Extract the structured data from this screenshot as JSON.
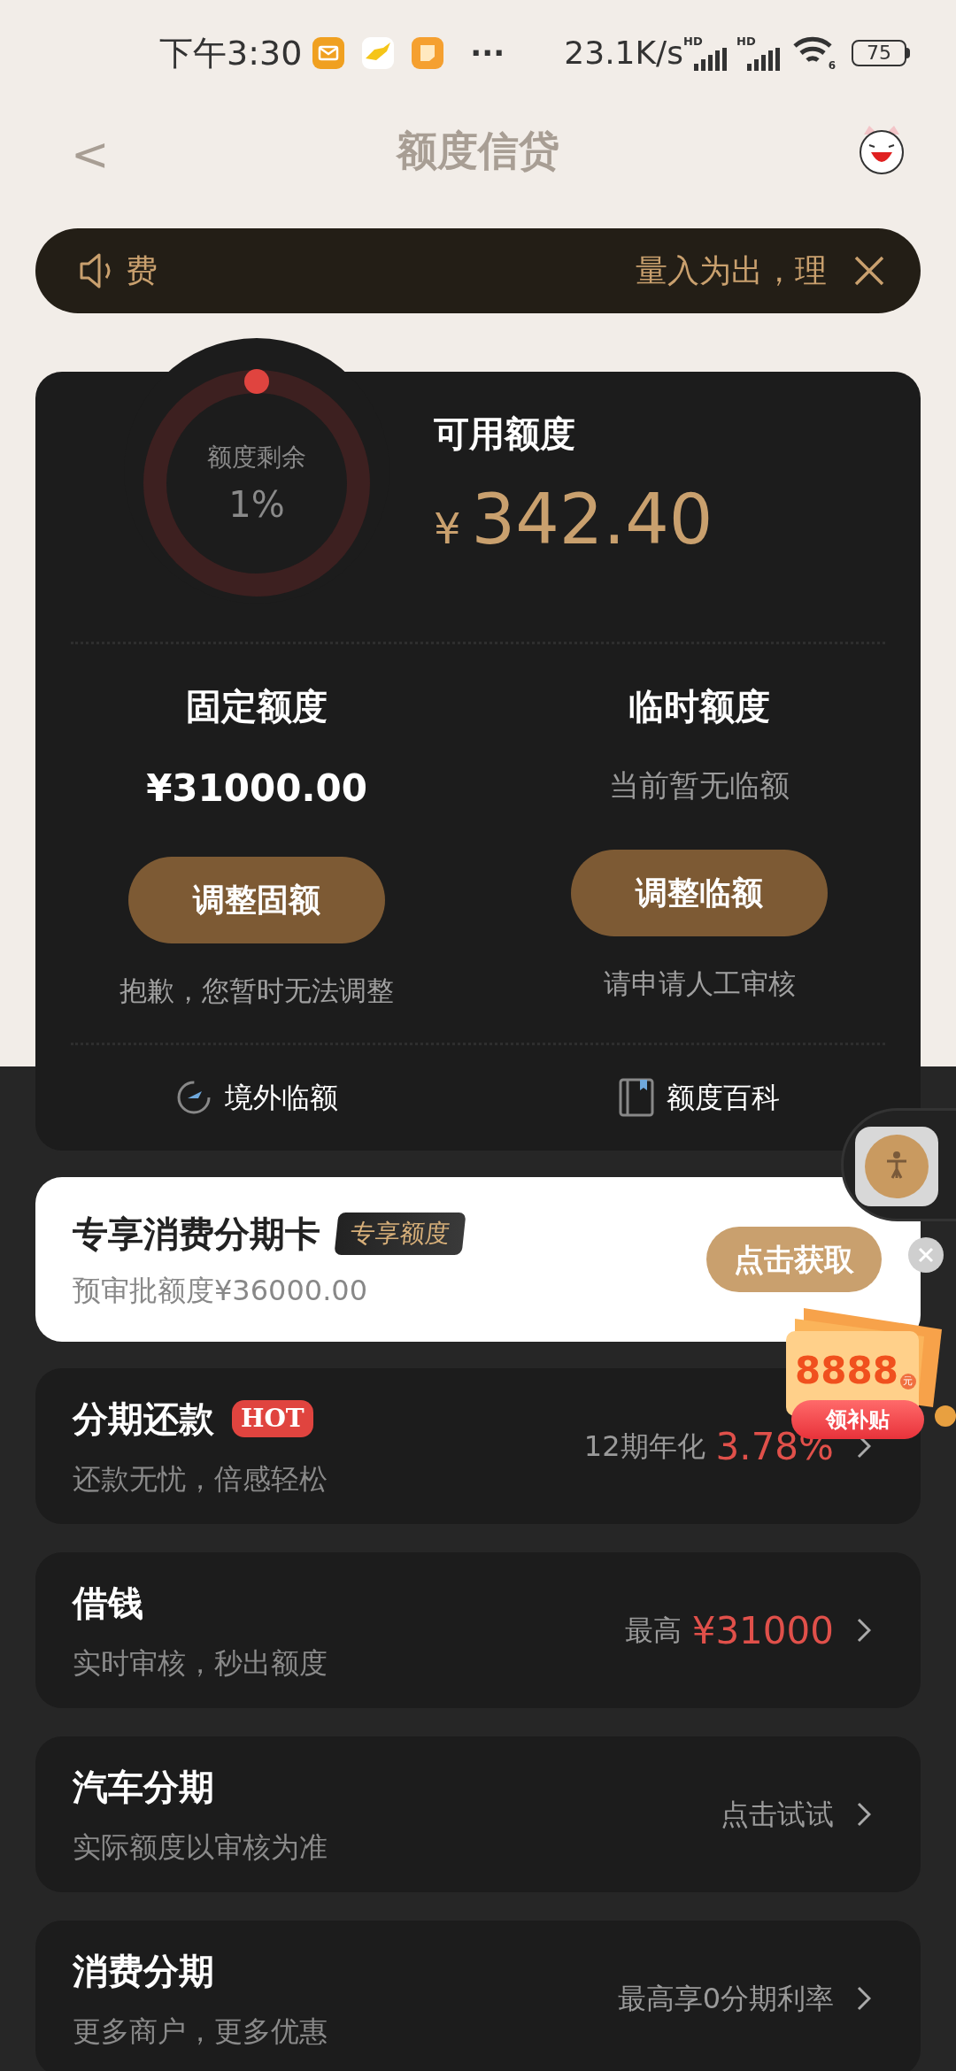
{
  "status_bar": {
    "time": "下午3:30",
    "more": "···",
    "speed": "23.1K/s",
    "sim_1": "HD",
    "sim_2": "HD",
    "wifi_slot": "6",
    "battery": "75"
  },
  "header": {
    "back": "<",
    "title": "额度信贷"
  },
  "notice": {
    "left_text": "费",
    "right_text": "量入为出，理"
  },
  "quota": {
    "ring_label": "额度剩余",
    "ring_percent": "1%",
    "available_label": "可用额度",
    "currency": "¥",
    "available_amount": "342.40"
  },
  "columns": [
    {
      "title": "固定额度",
      "value": "¥31000.00",
      "value_emphasized": true,
      "button": "调整固额",
      "note": "抱歉，您暂时无法调整"
    },
    {
      "title": "临时额度",
      "value": "当前暂无临额",
      "value_emphasized": false,
      "button": "调整临额",
      "note": "请申请人工审核"
    }
  ],
  "links": [
    {
      "kind": "plane",
      "label": "境外临额"
    },
    {
      "kind": "book",
      "label": "额度百科"
    }
  ],
  "promo": {
    "title": "专享消费分期卡",
    "tag": "专享额度",
    "subtitle": "预审批额度¥36000.00",
    "button": "点击获取"
  },
  "rows": [
    {
      "title": "分期还款",
      "badge": "HOT",
      "subtitle": "还款无忧，倍感轻松",
      "note": "12期年化",
      "highlight": "3.78%"
    },
    {
      "title": "借钱",
      "subtitle": "实时审核，秒出额度",
      "note": "最高",
      "highlight": "¥31000"
    },
    {
      "title": "汽车分期",
      "subtitle": "实际额度以审核为准",
      "note": "点击试试"
    },
    {
      "title": "消费分期",
      "subtitle": "更多商户，更多优惠",
      "note": "最高享0分期利率"
    }
  ],
  "coupon": {
    "amount": "8888",
    "unit": "元",
    "button": "领补贴"
  }
}
